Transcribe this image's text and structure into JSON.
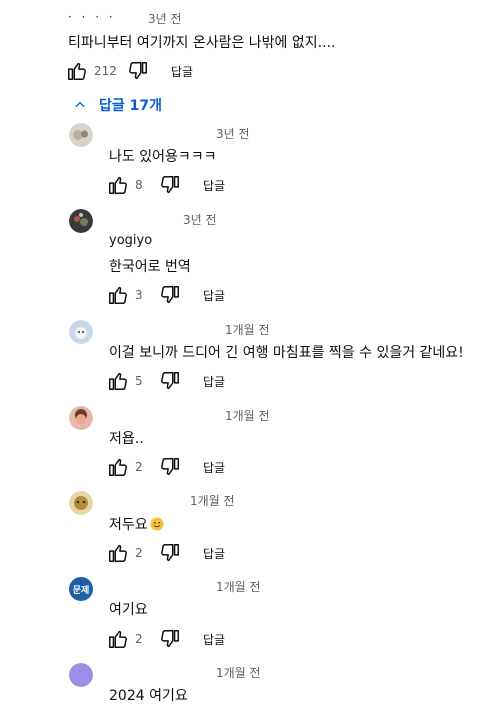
{
  "top_comment": {
    "author_partial": "· ·  · ·",
    "time": "3년 전",
    "text": "티파니부터 여기까지 온사람은 나밖에 없지....",
    "like_count": "212",
    "reply_label": "답글"
  },
  "replies_toggle": {
    "label": "답글 17개"
  },
  "replies": [
    {
      "author": "",
      "time": "3년 전",
      "text": "나도 있어용ㅋㅋㅋ",
      "like_count": "8",
      "reply_label": "답글"
    },
    {
      "author": "yogiyo",
      "time": "3년 전",
      "text": "한국어로 번역",
      "like_count": "3",
      "reply_label": "답글"
    },
    {
      "author": "",
      "time": "1개월 전",
      "text": "이걸 보니까 드디어 긴 여행 마침표를 찍을 수 있을거 같네요!",
      "like_count": "5",
      "reply_label": "답글"
    },
    {
      "author": "",
      "time": "1개월 전",
      "text": "저욥..",
      "like_count": "2",
      "reply_label": "답글"
    },
    {
      "author": "",
      "time": "1개월 전",
      "text": "저두요",
      "like_count": "2",
      "reply_label": "답글"
    },
    {
      "author": "",
      "time": "1개월 전",
      "text": "여기요",
      "like_count": "2",
      "reply_label": "답글"
    },
    {
      "author": "",
      "time": "1개월 전",
      "text": "2024 여기요"
    }
  ],
  "avatars": [
    {
      "icon": "avatar-photo-icon",
      "color": "#d9d3c9"
    },
    {
      "icon": "avatar-photo-icon",
      "color": "#3a3a3a"
    },
    {
      "icon": "avatar-photo-icon",
      "color": "#c9d8e6"
    },
    {
      "icon": "avatar-photo-icon",
      "color": "#d79a8a"
    },
    {
      "icon": "avatar-photo-icon",
      "color": "#b58a3c"
    },
    {
      "icon": "avatar-text-icon",
      "color": "#1f5fa8",
      "text": "문제"
    },
    {
      "icon": "avatar-plain-icon",
      "color": "#9b8ee6"
    }
  ],
  "colors": {
    "link_blue": "#065fd4",
    "meta_gray": "#606060",
    "text": "#0f0f0f"
  }
}
